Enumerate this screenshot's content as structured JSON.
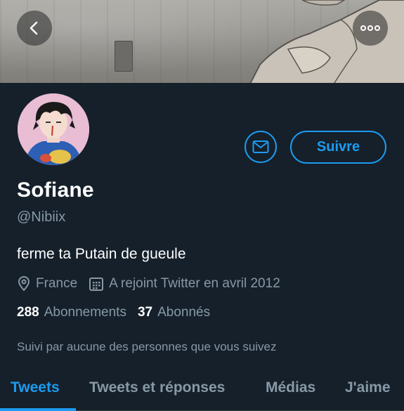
{
  "header": {
    "back_icon": "chevron-left-icon",
    "more_icon": "more-horizontal-icon"
  },
  "profile": {
    "name": "Sofiane",
    "handle": "@Nibiix",
    "bio": "ferme ta Putain de gueule",
    "location": "France",
    "joined": "A rejoint Twitter en avril 2012",
    "following_count": "288",
    "following_label": "Abonnements",
    "followers_count": "37",
    "followers_label": "Abonnés",
    "followed_by": "Suivi par aucune des personnes que vous suivez"
  },
  "actions": {
    "message_icon": "mail-icon",
    "follow_label": "Suivre"
  },
  "tabs": [
    {
      "label": "Tweets",
      "active": true
    },
    {
      "label": "Tweets et réponses",
      "active": false
    },
    {
      "label": "Médias",
      "active": false
    },
    {
      "label": "J'aime",
      "active": false
    }
  ],
  "colors": {
    "background": "#15202b",
    "accent": "#1d9bf0",
    "secondary_text": "#8899a6",
    "primary_text": "#ffffff"
  }
}
